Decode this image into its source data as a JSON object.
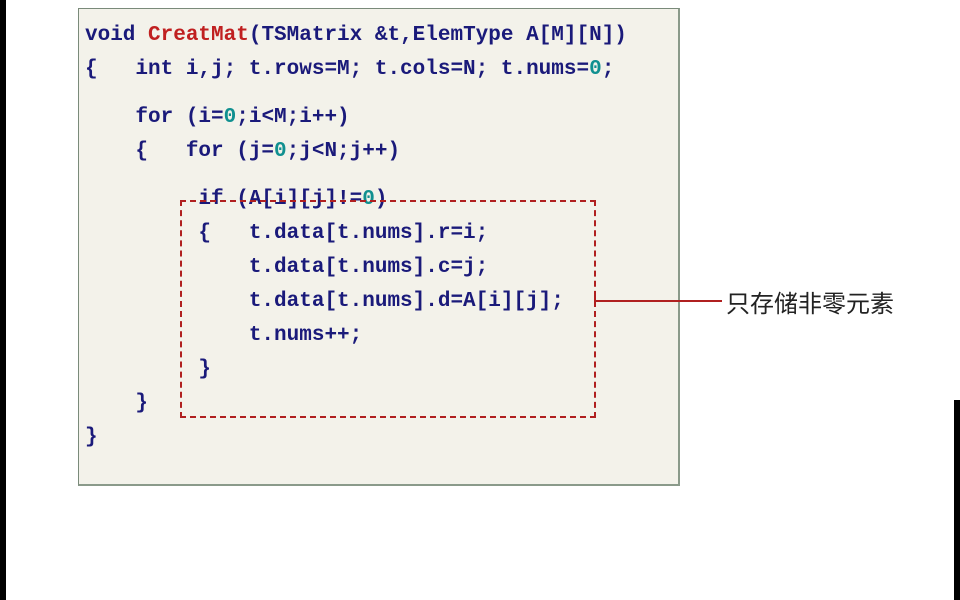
{
  "code": {
    "l1_a": "void ",
    "l1_fn": "CreatMat",
    "l1_b": "(TSMatrix &t,ElemType A[M][N])",
    "l2_a": "{   int i,j; t.rows=M; t.cols=N; t.nums=",
    "l2_num": "0",
    "l2_b": ";",
    "l3_a": "    for (i=",
    "l3_num": "0",
    "l3_b": ";i<M;i++)",
    "l4": "    {   for (j=",
    "l4_num": "0",
    "l4_b": ";j<N;j++)",
    "l5_a": "         if (A[i][j]!=",
    "l5_num": "0",
    "l5_b": ")",
    "l6": "         {   t.data[t.nums].r=i;",
    "l7": "             t.data[t.nums].c=j;",
    "l8": "             t.data[t.nums].d=A[i][j];",
    "l9": "             t.nums++;",
    "l10": "         }",
    "l11": "    }",
    "l12": "}"
  },
  "annotation": {
    "label": "只存储非零元素"
  }
}
